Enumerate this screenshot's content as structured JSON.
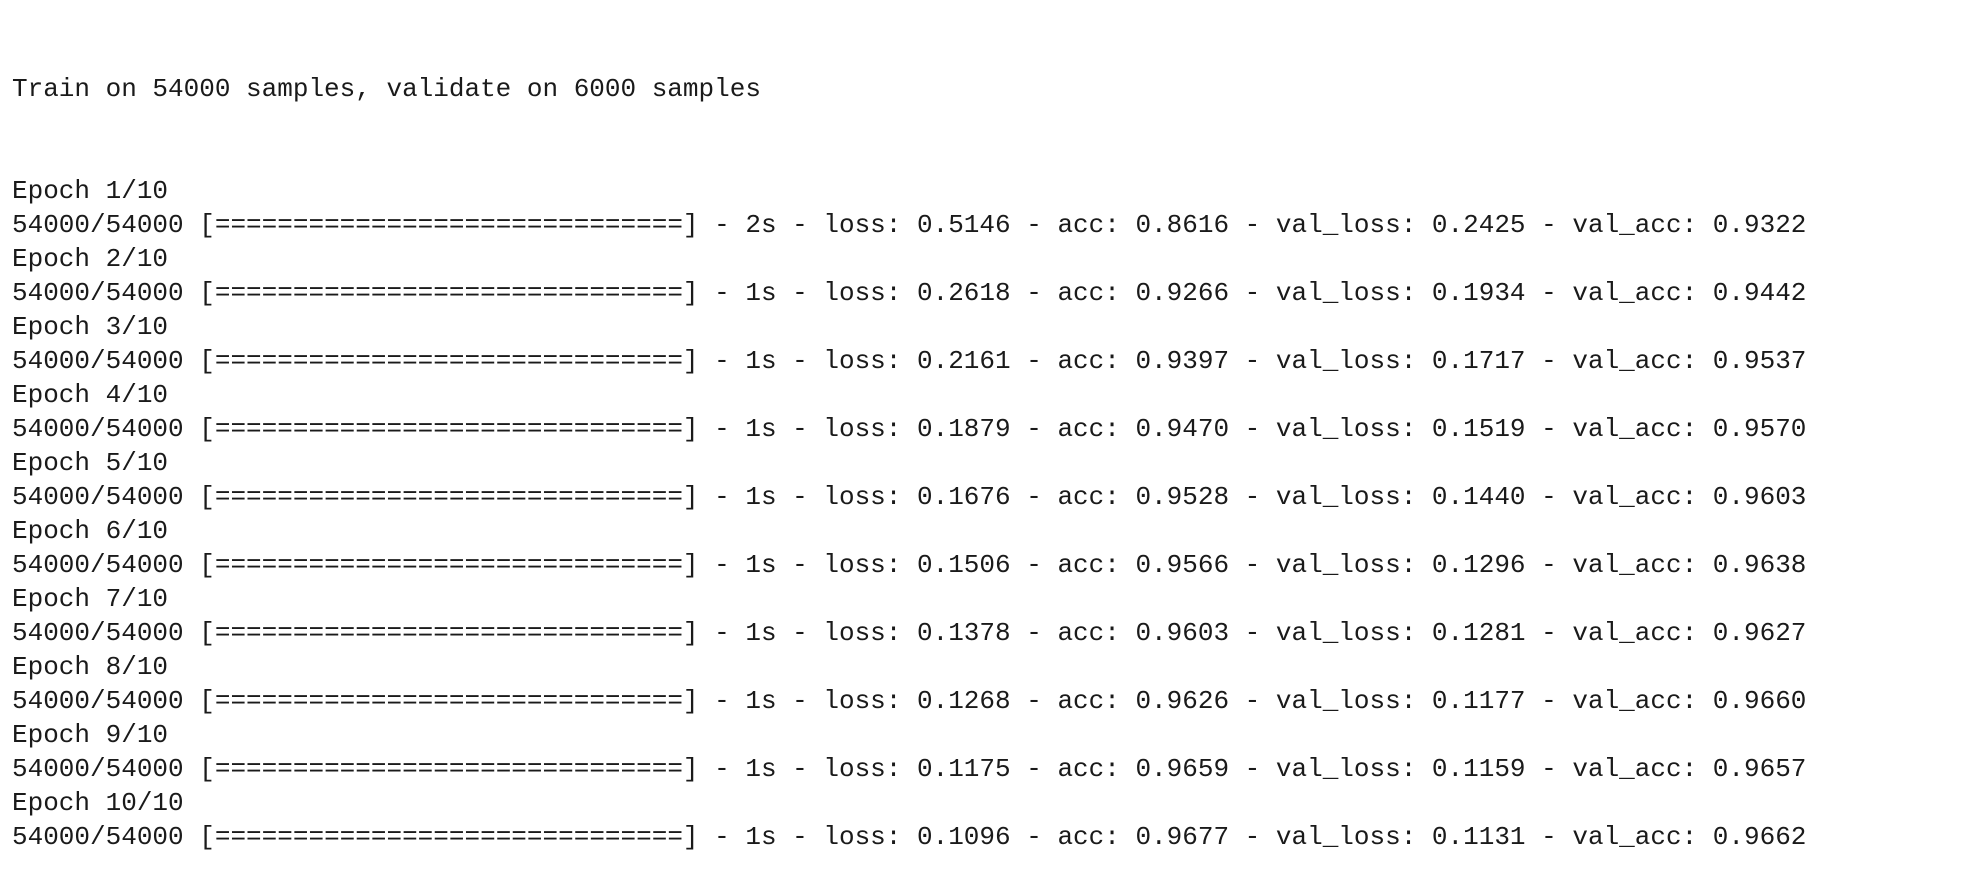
{
  "console": {
    "header": "Train on 54000 samples, validate on 6000 samples",
    "progress_bar": "[==============================]",
    "sep": " - ",
    "epochs": [
      {
        "label": "Epoch 1/10",
        "count": "54000/54000",
        "time": "2s",
        "loss": "0.5146",
        "acc": "0.8616",
        "val_loss": "0.2425",
        "val_acc": "0.9322"
      },
      {
        "label": "Epoch 2/10",
        "count": "54000/54000",
        "time": "1s",
        "loss": "0.2618",
        "acc": "0.9266",
        "val_loss": "0.1934",
        "val_acc": "0.9442"
      },
      {
        "label": "Epoch 3/10",
        "count": "54000/54000",
        "time": "1s",
        "loss": "0.2161",
        "acc": "0.9397",
        "val_loss": "0.1717",
        "val_acc": "0.9537"
      },
      {
        "label": "Epoch 4/10",
        "count": "54000/54000",
        "time": "1s",
        "loss": "0.1879",
        "acc": "0.9470",
        "val_loss": "0.1519",
        "val_acc": "0.9570"
      },
      {
        "label": "Epoch 5/10",
        "count": "54000/54000",
        "time": "1s",
        "loss": "0.1676",
        "acc": "0.9528",
        "val_loss": "0.1440",
        "val_acc": "0.9603"
      },
      {
        "label": "Epoch 6/10",
        "count": "54000/54000",
        "time": "1s",
        "loss": "0.1506",
        "acc": "0.9566",
        "val_loss": "0.1296",
        "val_acc": "0.9638"
      },
      {
        "label": "Epoch 7/10",
        "count": "54000/54000",
        "time": "1s",
        "loss": "0.1378",
        "acc": "0.9603",
        "val_loss": "0.1281",
        "val_acc": "0.9627"
      },
      {
        "label": "Epoch 8/10",
        "count": "54000/54000",
        "time": "1s",
        "loss": "0.1268",
        "acc": "0.9626",
        "val_loss": "0.1177",
        "val_acc": "0.9660"
      },
      {
        "label": "Epoch 9/10",
        "count": "54000/54000",
        "time": "1s",
        "loss": "0.1175",
        "acc": "0.9659",
        "val_loss": "0.1159",
        "val_acc": "0.9657"
      },
      {
        "label": "Epoch 10/10",
        "count": "54000/54000",
        "time": "1s",
        "loss": "0.1096",
        "acc": "0.9677",
        "val_loss": "0.1131",
        "val_acc": "0.9662"
      }
    ],
    "labels": {
      "loss": "loss: ",
      "acc": "acc: ",
      "val_loss": "val_loss: ",
      "val_acc": "val_acc: "
    }
  }
}
